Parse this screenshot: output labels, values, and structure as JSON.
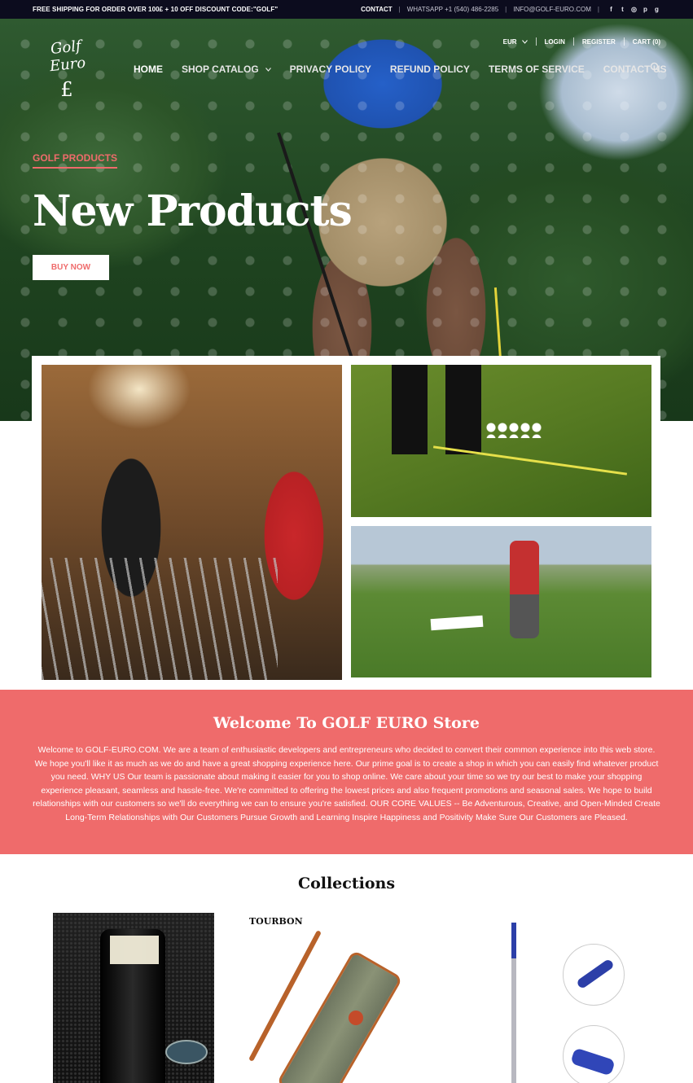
{
  "announcement": {
    "promo": "FREE SHIPPING FOR ORDER OVER 100£ + 10 OFF DISCOUNT CODE:\"GOLF\"",
    "contact": "CONTACT",
    "whatsapp": "WHATSAPP +1 (540) 486-2285",
    "email": "INFO@GOLF-EURO.COM",
    "social_icons": [
      "facebook-icon",
      "twitter-icon",
      "instagram-icon",
      "pinterest-icon",
      "google-plus-icon"
    ]
  },
  "logo": {
    "word": "Golf Euro",
    "symbol": "£"
  },
  "utility": {
    "currency": "EUR",
    "login": "LOGIN",
    "register": "REGISTER",
    "cart": "CART (0)"
  },
  "nav": {
    "items": [
      {
        "label": "HOME",
        "active": true
      },
      {
        "label": "SHOP CATALOG",
        "has_dropdown": true
      },
      {
        "label": "PRIVACY POLICY"
      },
      {
        "label": "REFUND POLICY"
      },
      {
        "label": "TERMS OF SERVICE"
      },
      {
        "label": "CONTACT US"
      }
    ],
    "search_icon": "search-icon"
  },
  "hero": {
    "kicker": "GOLF PRODUCTS",
    "headline": "New Products",
    "button": "BUY NOW",
    "prev_icon": "chevron-left-icon",
    "next_icon": "chevron-right-icon"
  },
  "welcome": {
    "title": "Welcome To GOLF EURO Store",
    "body": "Welcome to GOLF-EURO.COM. We are a team of enthusiastic developers and entrepreneurs who decided to convert their common experience into this web store. We hope you'll like it as much as we do and have a great shopping experience here. Our prime goal is to create a shop in which you can easily find whatever product you need. WHY US Our team is passionate about making it easier for you to shop online. We care about your time so we try our best to make your shopping experience pleasant, seamless and hassle-free. We're committed to offering the lowest prices and also frequent promotions and seasonal sales. We hope to build relationships with our customers so we'll do everything we can to ensure you're satisfied. OUR CORE VALUES -- Be Adventurous, Creative, and Open-Minded Create Long-Term Relationships with Our Customers Pursue Growth and Learning Inspire Happiness and Positivity Make Sure Our Customers are Pleased."
  },
  "collections": {
    "title": "Collections",
    "brand_mark": "TOURBON"
  },
  "colors": {
    "accent": "#ef6b6b",
    "topbar": "#0c0c1e"
  }
}
